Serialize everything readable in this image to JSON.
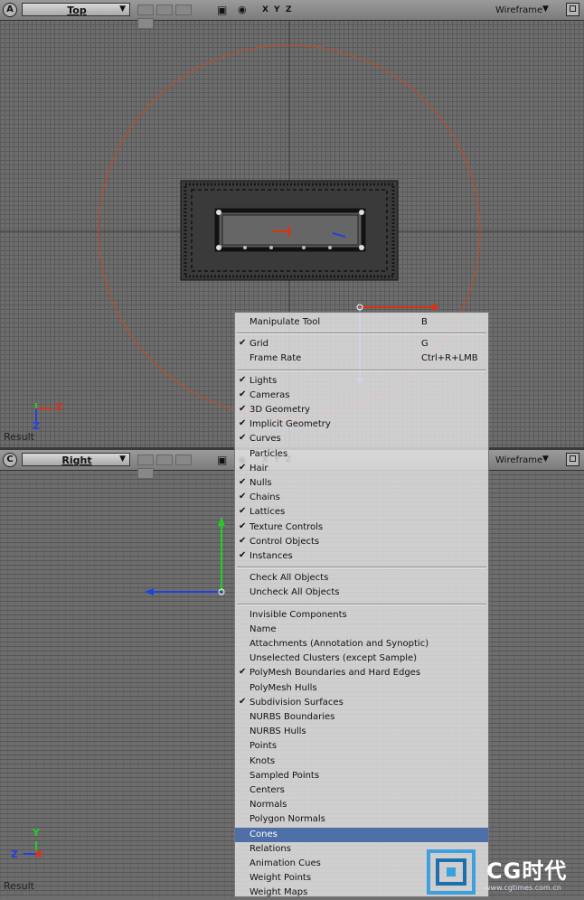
{
  "viewport_a": {
    "letter": "A",
    "camera": "Top",
    "axes": [
      "X",
      "Y",
      "Z"
    ],
    "mode": "Wireframe",
    "result": "Result",
    "gizmo_x": "X",
    "gizmo_z": "Z"
  },
  "viewport_c": {
    "letter": "C",
    "camera": "Right",
    "axes": [
      "X",
      "Y",
      "Z"
    ],
    "mode": "Wireframe",
    "result": "Result",
    "gizmo_y": "Y",
    "gizmo_z": "Z",
    "gizmo_x": "X"
  },
  "colors": {
    "highlight": "#4f6fa8",
    "circle": "#c84a1e",
    "axis_red": "#e03010",
    "axis_green": "#20d020",
    "axis_blue": "#2040e0"
  },
  "menu": {
    "items": [
      {
        "label": "Manipulate Tool",
        "shortcut": "B",
        "checked": false
      },
      {
        "label": "Grid",
        "shortcut": "G",
        "checked": true
      },
      {
        "label": "Frame Rate",
        "shortcut": "Ctrl+R+LMB",
        "checked": false
      },
      {
        "label": "Lights",
        "checked": true
      },
      {
        "label": "Cameras",
        "checked": true
      },
      {
        "label": "3D Geometry",
        "checked": true
      },
      {
        "label": "Implicit Geometry",
        "checked": true
      },
      {
        "label": "Curves",
        "checked": true
      },
      {
        "label": "Particles",
        "checked": false
      },
      {
        "label": "Hair",
        "checked": true
      },
      {
        "label": "Nulls",
        "checked": true
      },
      {
        "label": "Chains",
        "checked": true
      },
      {
        "label": "Lattices",
        "checked": true
      },
      {
        "label": "Texture Controls",
        "checked": true
      },
      {
        "label": "Control Objects",
        "checked": true
      },
      {
        "label": "Instances",
        "checked": true
      },
      {
        "label": "Check All Objects",
        "checked": false
      },
      {
        "label": "Uncheck All Objects",
        "checked": false
      },
      {
        "label": "Invisible Components",
        "checked": false
      },
      {
        "label": "Name",
        "checked": false
      },
      {
        "label": "Attachments (Annotation and Synoptic)",
        "checked": false
      },
      {
        "label": "Unselected Clusters (except Sample)",
        "checked": false
      },
      {
        "label": "PolyMesh Boundaries and Hard Edges",
        "checked": true
      },
      {
        "label": "PolyMesh Hulls",
        "checked": false
      },
      {
        "label": "Subdivision Surfaces",
        "checked": true
      },
      {
        "label": "NURBS Boundaries",
        "checked": false
      },
      {
        "label": "NURBS Hulls",
        "checked": false
      },
      {
        "label": "Points",
        "checked": false
      },
      {
        "label": "Knots",
        "checked": false
      },
      {
        "label": "Sampled Points",
        "checked": false
      },
      {
        "label": "Centers",
        "checked": false
      },
      {
        "label": "Normals",
        "checked": false
      },
      {
        "label": "Polygon Normals",
        "checked": false
      },
      {
        "label": "Cones",
        "checked": false,
        "highlighted": true
      },
      {
        "label": "Relations",
        "checked": false
      },
      {
        "label": "Animation Cues",
        "checked": false
      },
      {
        "label": "Weight Points",
        "checked": false
      },
      {
        "label": "Weight Maps",
        "checked": false
      }
    ]
  },
  "watermark": {
    "brand": "CG时代",
    "url": "www.cgtimes.com.cn"
  }
}
